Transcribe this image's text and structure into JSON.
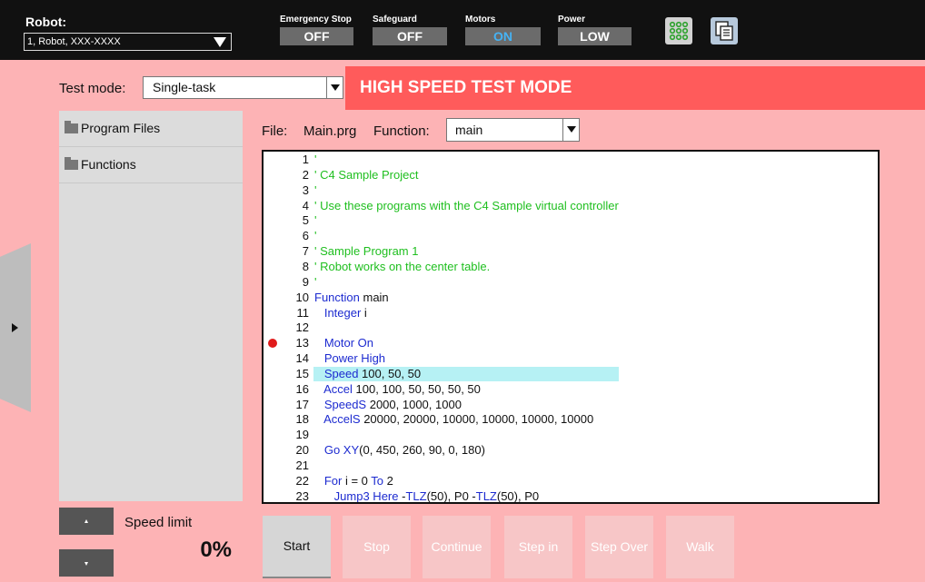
{
  "topbar": {
    "robot_label": "Robot:",
    "robot_selected": "1, Robot, XXX-XXXX",
    "statuses": [
      {
        "label": "Emergency Stop",
        "value": "OFF"
      },
      {
        "label": "Safeguard",
        "value": "OFF"
      },
      {
        "label": "Motors",
        "value": "ON"
      },
      {
        "label": "Power",
        "value": "LOW"
      }
    ],
    "icons": [
      "io-monitor-icon",
      "task-manager-icon"
    ]
  },
  "test_mode": {
    "label": "Test mode:",
    "selected": "Single-task"
  },
  "banner": {
    "text": "HIGH SPEED TEST MODE",
    "color": "#ff5b5b"
  },
  "file_tree": {
    "items": [
      {
        "label": "Program Files"
      },
      {
        "label": "Functions"
      }
    ]
  },
  "file_bar": {
    "file_label": "File:",
    "file_name": "Main.prg",
    "function_label": "Function:",
    "function_selected": "main"
  },
  "editor": {
    "breakpoint_line": 13,
    "highlight_line": 15,
    "lines": [
      {
        "n": "1",
        "segments": [
          {
            "t": "'",
            "c": "green"
          }
        ]
      },
      {
        "n": "2",
        "segments": [
          {
            "t": "' C4 Sample Project",
            "c": "green"
          }
        ]
      },
      {
        "n": "3",
        "segments": [
          {
            "t": "'",
            "c": "green"
          }
        ]
      },
      {
        "n": "4",
        "segments": [
          {
            "t": "' Use these programs with the C4 Sample virtual controller",
            "c": "green"
          }
        ]
      },
      {
        "n": "5",
        "segments": [
          {
            "t": "'",
            "c": "green"
          }
        ]
      },
      {
        "n": "6",
        "segments": [
          {
            "t": "'",
            "c": "green"
          }
        ]
      },
      {
        "n": "7",
        "segments": [
          {
            "t": "' Sample Program 1",
            "c": "green"
          }
        ]
      },
      {
        "n": "8",
        "segments": [
          {
            "t": "' Robot works on the center table.",
            "c": "green"
          }
        ]
      },
      {
        "n": "9",
        "segments": [
          {
            "t": "'",
            "c": "green"
          }
        ]
      },
      {
        "n": "10",
        "segments": [
          {
            "t": "Function",
            "c": "blue"
          },
          {
            "t": " main",
            "c": "black"
          }
        ]
      },
      {
        "n": "11",
        "segments": [
          {
            "t": "   Integer",
            "c": "blue"
          },
          {
            "t": " i",
            "c": "black"
          }
        ]
      },
      {
        "n": "12",
        "segments": []
      },
      {
        "n": "13",
        "segments": [
          {
            "t": "   Motor On",
            "c": "blue"
          }
        ]
      },
      {
        "n": "14",
        "segments": [
          {
            "t": "   Power High",
            "c": "blue"
          }
        ]
      },
      {
        "n": "15",
        "segments": [
          {
            "t": "   Speed",
            "c": "blue"
          },
          {
            "t": " 100, 50, 50",
            "c": "black"
          }
        ]
      },
      {
        "n": "16",
        "segments": [
          {
            "t": "   Accel",
            "c": "blue"
          },
          {
            "t": " 100, 100, 50, 50, 50, 50",
            "c": "black"
          }
        ]
      },
      {
        "n": "17",
        "segments": [
          {
            "t": "   SpeedS",
            "c": "blue"
          },
          {
            "t": " 2000, 1000, 1000",
            "c": "black"
          }
        ]
      },
      {
        "n": "18",
        "segments": [
          {
            "t": "   AccelS",
            "c": "blue"
          },
          {
            "t": " 20000, 20000, 10000, 10000, 10000, 10000",
            "c": "black"
          }
        ]
      },
      {
        "n": "19",
        "segments": []
      },
      {
        "n": "20",
        "segments": [
          {
            "t": "   Go XY",
            "c": "blue"
          },
          {
            "t": "(0, 450, 260, 90, 0, 180)",
            "c": "black"
          }
        ]
      },
      {
        "n": "21",
        "segments": []
      },
      {
        "n": "22",
        "segments": [
          {
            "t": "   For",
            "c": "blue"
          },
          {
            "t": " i = 0 ",
            "c": "black"
          },
          {
            "t": "To",
            "c": "blue"
          },
          {
            "t": " 2",
            "c": "black"
          }
        ]
      },
      {
        "n": "23",
        "segments": [
          {
            "t": "      Jump3 Here",
            "c": "blue"
          },
          {
            "t": " -",
            "c": "black"
          },
          {
            "t": "TLZ",
            "c": "blue"
          },
          {
            "t": "(50), P0 -",
            "c": "black"
          },
          {
            "t": "TLZ",
            "c": "blue"
          },
          {
            "t": "(50), P0",
            "c": "black"
          }
        ]
      }
    ]
  },
  "speed_limit": {
    "label": "Speed limit",
    "value": "0%"
  },
  "actions": [
    {
      "label": "Start",
      "enabled": true
    },
    {
      "label": "Stop",
      "enabled": false
    },
    {
      "label": "Continue",
      "enabled": false
    },
    {
      "label": "Step in",
      "enabled": false
    },
    {
      "label": "Step Over",
      "enabled": false
    },
    {
      "label": "Walk",
      "enabled": false
    }
  ]
}
